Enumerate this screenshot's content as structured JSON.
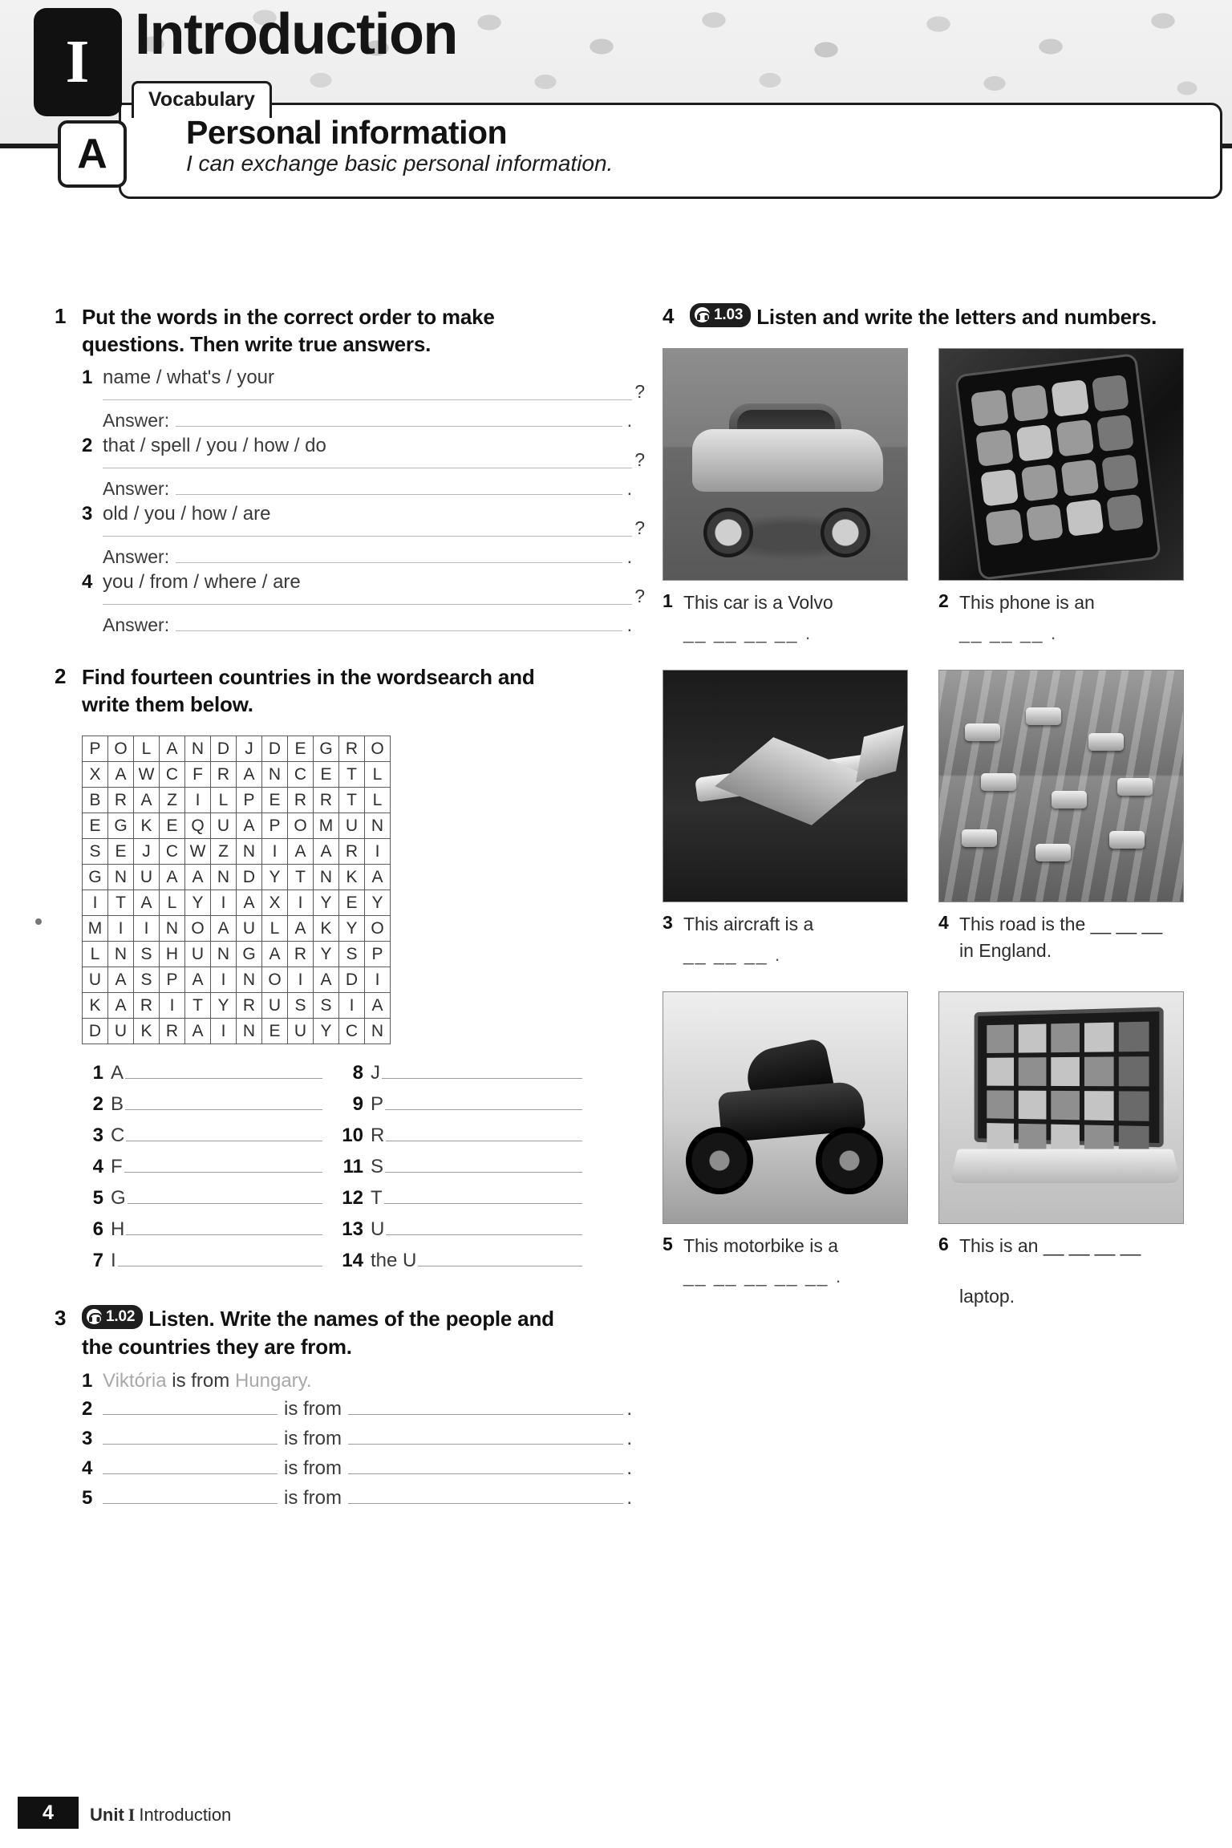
{
  "header": {
    "unit_letter": "I",
    "unit_title": "Introduction",
    "section_tab": "Vocabulary",
    "lesson_letter": "A",
    "lesson_title": "Personal information",
    "can_do": "I can exchange basic personal information."
  },
  "exercise1": {
    "number": "1",
    "instruction": "Put the words in the correct order to make questions. Then write true answers.",
    "answer_label": "Answer:",
    "question_mark": "?",
    "period": ".",
    "items": [
      {
        "n": "1",
        "words": "name / what's / your"
      },
      {
        "n": "2",
        "words": "that / spell / you / how / do"
      },
      {
        "n": "3",
        "words": "old / you / how / are"
      },
      {
        "n": "4",
        "words": "you / from / where / are"
      }
    ]
  },
  "exercise2": {
    "number": "2",
    "instruction": "Find fourteen countries in the wordsearch and write them below.",
    "grid": [
      [
        "P",
        "O",
        "L",
        "A",
        "N",
        "D",
        "J",
        "D",
        "E",
        "G",
        "R",
        "O"
      ],
      [
        "X",
        "A",
        "W",
        "C",
        "F",
        "R",
        "A",
        "N",
        "C",
        "E",
        "T",
        "L"
      ],
      [
        "B",
        "R",
        "A",
        "Z",
        "I",
        "L",
        "P",
        "E",
        "R",
        "R",
        "T",
        "L"
      ],
      [
        "E",
        "G",
        "K",
        "E",
        "Q",
        "U",
        "A",
        "P",
        "O",
        "M",
        "U",
        "N"
      ],
      [
        "S",
        "E",
        "J",
        "C",
        "W",
        "Z",
        "N",
        "I",
        "A",
        "A",
        "R",
        "I"
      ],
      [
        "G",
        "N",
        "U",
        "A",
        "A",
        "N",
        "D",
        "Y",
        "T",
        "N",
        "K",
        "A"
      ],
      [
        "I",
        "T",
        "A",
        "L",
        "Y",
        "I",
        "A",
        "X",
        "I",
        "Y",
        "E",
        "Y"
      ],
      [
        "M",
        "I",
        "I",
        "N",
        "O",
        "A",
        "U",
        "L",
        "A",
        "K",
        "Y",
        "O"
      ],
      [
        "L",
        "N",
        "S",
        "H",
        "U",
        "N",
        "G",
        "A",
        "R",
        "Y",
        "S",
        "P"
      ],
      [
        "U",
        "A",
        "S",
        "P",
        "A",
        "I",
        "N",
        "O",
        "I",
        "A",
        "D",
        "I"
      ],
      [
        "K",
        "A",
        "R",
        "I",
        "T",
        "Y",
        "R",
        "U",
        "S",
        "S",
        "I",
        "A"
      ],
      [
        "D",
        "U",
        "K",
        "R",
        "A",
        "I",
        "N",
        "E",
        "U",
        "Y",
        "C",
        "N"
      ]
    ],
    "blanks_left": [
      {
        "n": "1",
        "letter": "A"
      },
      {
        "n": "2",
        "letter": "B"
      },
      {
        "n": "3",
        "letter": "C"
      },
      {
        "n": "4",
        "letter": "F"
      },
      {
        "n": "5",
        "letter": "G"
      },
      {
        "n": "6",
        "letter": "H"
      },
      {
        "n": "7",
        "letter": "I"
      }
    ],
    "blanks_right": [
      {
        "n": "8",
        "letter": "J"
      },
      {
        "n": "9",
        "letter": "P"
      },
      {
        "n": "10",
        "letter": "R"
      },
      {
        "n": "11",
        "letter": "S"
      },
      {
        "n": "12",
        "letter": "T"
      },
      {
        "n": "13",
        "letter": "U"
      },
      {
        "n": "14",
        "letter": "the U"
      }
    ]
  },
  "exercise3": {
    "number": "3",
    "audio_track": "1.02",
    "instruction": "Listen. Write the names of the people and the countries they are from.",
    "connector": "is from",
    "period": ".",
    "example": {
      "n": "1",
      "name": "Viktória",
      "mid": "is from",
      "country": "Hungary."
    },
    "rows": [
      {
        "n": "2"
      },
      {
        "n": "3"
      },
      {
        "n": "4"
      },
      {
        "n": "5"
      }
    ]
  },
  "exercise4": {
    "number": "4",
    "audio_track": "1.03",
    "instruction": "Listen and write the letters and numbers.",
    "items": [
      {
        "n": "1",
        "caption": "This car is a Volvo",
        "dashes": "__  __  __  __ .",
        "extra": "",
        "photo": "photo-car"
      },
      {
        "n": "2",
        "caption": "This phone is an",
        "dashes": "__  __  __ .",
        "extra": "",
        "photo": "photo-phone"
      },
      {
        "n": "3",
        "caption": "This aircraft is a",
        "dashes": "__  __  __ .",
        "extra": "",
        "photo": "photo-aircraft"
      },
      {
        "n": "4",
        "caption": "This road is the __  __  __",
        "dashes": "",
        "extra": "in England.",
        "photo": "photo-road"
      },
      {
        "n": "5",
        "caption": "This motorbike is a",
        "dashes": "__  __  __  __  __ .",
        "extra": "",
        "photo": "photo-motorbike"
      },
      {
        "n": "6",
        "caption": "This is an __  __  __  __",
        "dashes": "",
        "extra": "laptop.",
        "photo": "photo-laptop"
      }
    ]
  },
  "footer": {
    "page_number": "4",
    "unit_word": "Unit",
    "unit_letter": "I",
    "unit_name": "Introduction"
  }
}
